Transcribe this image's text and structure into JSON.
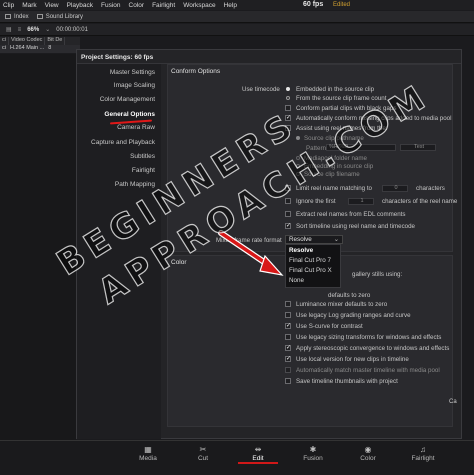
{
  "menubar": {
    "items": [
      "Clip",
      "Mark",
      "View",
      "Playback",
      "Fusion",
      "Color",
      "Fairlight",
      "Workspace",
      "Help"
    ],
    "fps": "60 fps",
    "status": "Edited"
  },
  "toolbar": {
    "index_label": "Index",
    "sound_library_label": "Sound Library"
  },
  "bar2": {
    "zoom": "66%",
    "timecode": "00:00:00:01"
  },
  "media_columns": [
    "ci",
    "Video Codec",
    "Bit De"
  ],
  "media_row": [
    "ci",
    "H.264 Main ...",
    "8"
  ],
  "dialog": {
    "title": "Project Settings: 60 fps",
    "sidebar": [
      "Master Settings",
      "Image Scaling",
      "Color Management",
      "General Options",
      "Camera Raw",
      "Capture and Playback",
      "Subtitles",
      "Fairlight",
      "Path Mapping"
    ],
    "active_item": "General Options",
    "conform": {
      "heading": "Conform Options",
      "use_timecode_label": "Use timecode",
      "radio_embedded": "Embedded in the source clip",
      "radio_frame_count": "From the source clip frame count",
      "conform_partial": "Conform partial clips with black gaps",
      "auto_conform": "Automatically conform missing clips added to media pool",
      "assist_reel": "Assist using reel names from the:",
      "source_clip_pathname": "Source clip pathname",
      "pattern_label": "Pattern",
      "pattern_value": "%R/%D",
      "test_label": "Test",
      "mediapool_folder": "Mediapool folder name",
      "embedding_source_clip": "Embedding in source clip",
      "source_clip_filename": "Source clip filename",
      "limit_reel": "Limit reel name matching to",
      "limit_value": "0",
      "characters_label": "characters",
      "ignore_first": "Ignore the first",
      "ignore_value": "1",
      "chars_of_reel": "characters of the reel name",
      "extract_edl": "Extract reel names from EDL comments",
      "sort_timeline": "Sort timeline using reel name and timecode",
      "mixed_frame_rate": "Mixed frame rate format",
      "mixed_value": "Resolve",
      "dropdown_options": [
        "Resolve",
        "Final Cut Pro 7",
        "Final Cut Pro X",
        "None"
      ]
    },
    "color": {
      "heading": "Color",
      "items": [
        "gallery stills using:",
        "defaults to zero",
        "Luminance mixer defaults to zero",
        "Use legacy Log grading ranges and curve",
        "Use S-curve for contrast",
        "Use legacy sizing transforms for windows and effects",
        "Apply stereoscopic convergence to windows and effects",
        "Use local version for new clips in timeline",
        "Automatically match master timeline with media pool",
        "Save timeline thumbnails with project"
      ],
      "checked": [
        false,
        false,
        false,
        true,
        true,
        false,
        true,
        true,
        false,
        false
      ]
    },
    "cancel_fragment": "Ca"
  },
  "page_nav": {
    "items": [
      "Media",
      "Cut",
      "Edit",
      "Fusion",
      "Color",
      "Fairlight"
    ],
    "icons": [
      "film-strip-icon",
      "scissors-icon",
      "edit-icon",
      "fusion-icon",
      "color-wheel-icon",
      "music-note-icon"
    ],
    "active": "Edit"
  },
  "watermark": {
    "line1": "BEGINNERS",
    "line2": "APPROACH.COM"
  },
  "colors": {
    "accent_red": "#e01818",
    "edited_status": "#d0a030",
    "background": "#1b1b1e"
  }
}
